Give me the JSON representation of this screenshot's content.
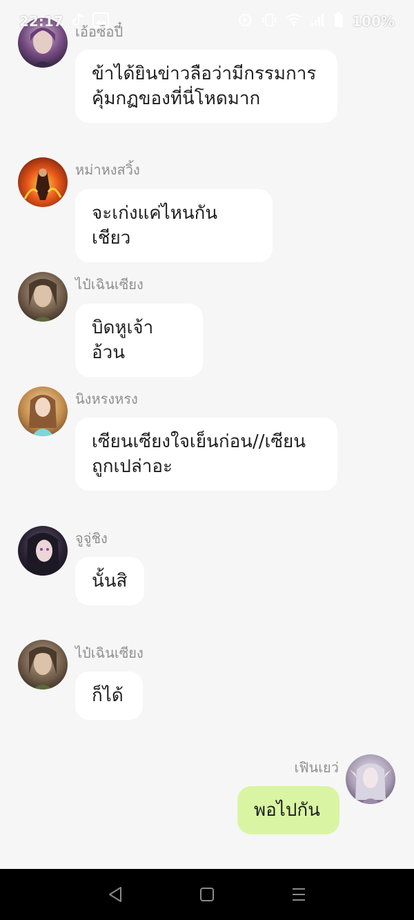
{
  "status": {
    "time": "22:17",
    "battery": "100%",
    "icons": [
      "tiktok-icon",
      "gallery-icon",
      "location-icon",
      "vibrate-icon",
      "wifi-icon",
      "signal-icon",
      "battery-icon"
    ]
  },
  "messages": [
    {
      "sender": "เอ้อซือปี๋",
      "text": "ข้าได้ยินข่าวลือว่ามีกรรมการคุ้มกฏของที่นี่โหดมาก",
      "mine": false,
      "avatar": "avatar-male-purple-icon"
    },
    {
      "sender": "หม่าหงสวิ้ง",
      "text": "จะเก่งแค่ไหนกันเชียว",
      "mine": false,
      "avatar": "avatar-fire-warrior-icon"
    },
    {
      "sender": "ไป๋เฉินเซียง",
      "text": "บิดหูเจ้าอ้วน",
      "mine": false,
      "avatar": "avatar-elf-icon"
    },
    {
      "sender": "นิงหรงหรง",
      "text": "เซียนเซียงใจเย็นก่อน//เซียนถูกเปล่าอะ",
      "mine": false,
      "avatar": "avatar-girl-blue-icon"
    },
    {
      "sender": "จูจู่ชิง",
      "text": "นั้นสิ",
      "mine": false,
      "avatar": "avatar-girl-dark-icon"
    },
    {
      "sender": "ไป๋เฉินเซียง",
      "text": "ก็ได้",
      "mine": false,
      "avatar": "avatar-elf-icon"
    },
    {
      "sender": "เฟินเยว่",
      "text": "พอไปกัน",
      "mine": true,
      "avatar": "avatar-elf-silver-icon"
    }
  ],
  "colors": {
    "background": "#f6f6f6",
    "bubble": "#ffffff",
    "bubble_mine": "#d9f5a3",
    "sender": "#8f8f8f",
    "navbar": "#000000"
  },
  "nav": [
    "back-icon",
    "home-icon",
    "recents-icon"
  ]
}
